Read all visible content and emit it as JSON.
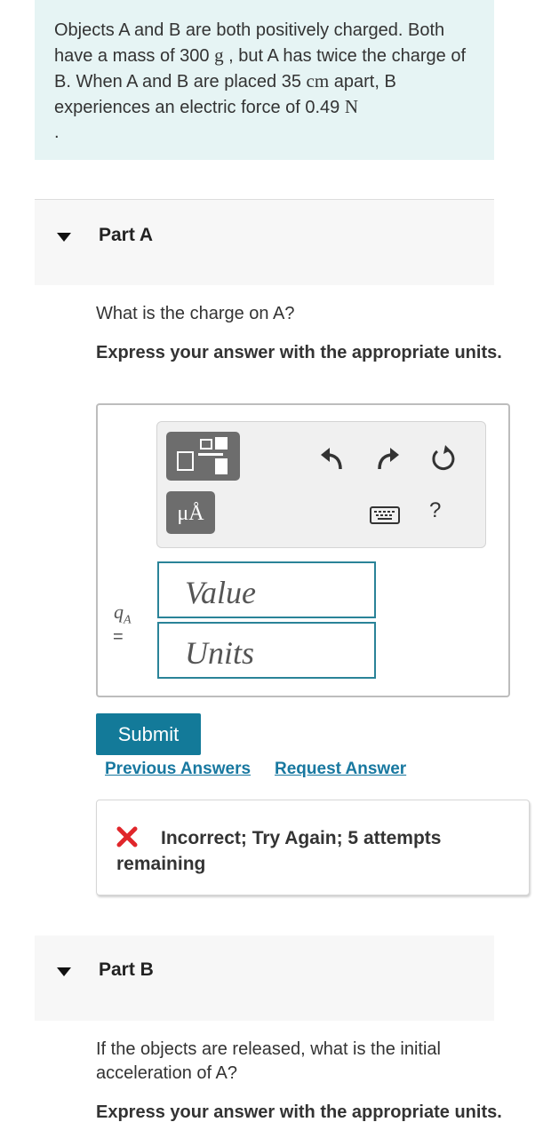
{
  "problem": {
    "text_1": "Objects A and B are both positively charged. Both have a mass of 300 ",
    "unit_mass": "g",
    "text_2": " , but A has twice the charge of B. When A and B are placed 35 ",
    "unit_distance": "cm",
    "text_3": " apart, B experiences an electric force of 0.49 ",
    "unit_force": "N",
    "text_4": "."
  },
  "part_a": {
    "title": "Part A",
    "question": "What is the charge on A?",
    "instruction": "Express your answer with the appropriate units.",
    "toolbar": {
      "fraction_icon": "fraction-template-icon",
      "units_button": "μÅ",
      "undo_icon": "undo-icon",
      "redo_icon": "redo-icon",
      "reset_icon": "reset-icon",
      "keyboard_icon": "keyboard-icon",
      "help_label": "?"
    },
    "variable": "q",
    "variable_sub": "A",
    "equals": "=",
    "value_placeholder": "Value",
    "units_placeholder": "Units",
    "submit_label": "Submit",
    "previous_answers_label": "Previous Answers",
    "request_answer_label": "Request Answer",
    "feedback": "Incorrect; Try Again; 5 attempts remaining",
    "feedback_color": "#e0262b"
  },
  "part_b": {
    "title": "Part B",
    "question": "If the objects are released, what is the initial acceleration of A?",
    "instruction": "Express your answer with the appropriate units."
  }
}
